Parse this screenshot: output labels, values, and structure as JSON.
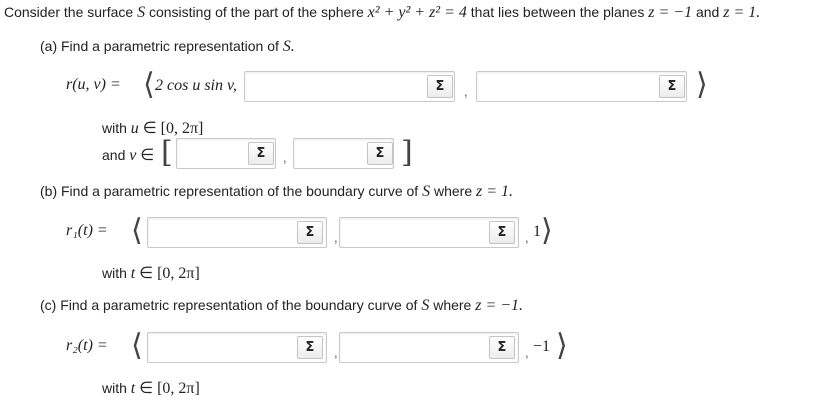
{
  "intro": {
    "text_a": "Consider the surface",
    "S": "S",
    "text_b": "consisting of the part of the sphere",
    "sphere_eq": "x² + y² + z² = 4",
    "text_c": "that lies between the planes",
    "plane1": "z = −1",
    "and": "and",
    "plane2": "z = 1."
  },
  "part_a": {
    "label": "(a) Find a parametric representation of",
    "S": "S.",
    "r_lhs": "r(u, v) =",
    "first_comp": "2 cos u sin v,",
    "with_u": "with",
    "u_var": "u",
    "u_in": "∈ [0, 2π]",
    "and_v": "and",
    "v_var": "v",
    "v_in": "∈"
  },
  "part_b": {
    "label": "(b) Find a parametric representation of the boundary curve of",
    "S": "S",
    "where": "where",
    "cond": "z = 1.",
    "r_lhs": "r₁(t) =",
    "last_comp": "1",
    "with": "with",
    "t_var": "t",
    "t_in": "∈ [0, 2π]"
  },
  "part_c": {
    "label": "(c) Find a parametric representation of the boundary curve of",
    "S": "S",
    "where": "where",
    "cond": "z = −1.",
    "r_lhs": "r₂(t) =",
    "last_comp": "−1",
    "with": "with",
    "t_var": "t",
    "t_in": "∈ [0, 2π]"
  },
  "common": {
    "sigma": "Σ",
    "comma": ",",
    "open_angle": "⟨",
    "close_angle": "⟩",
    "open_bracket": "[",
    "close_bracket": "]"
  }
}
